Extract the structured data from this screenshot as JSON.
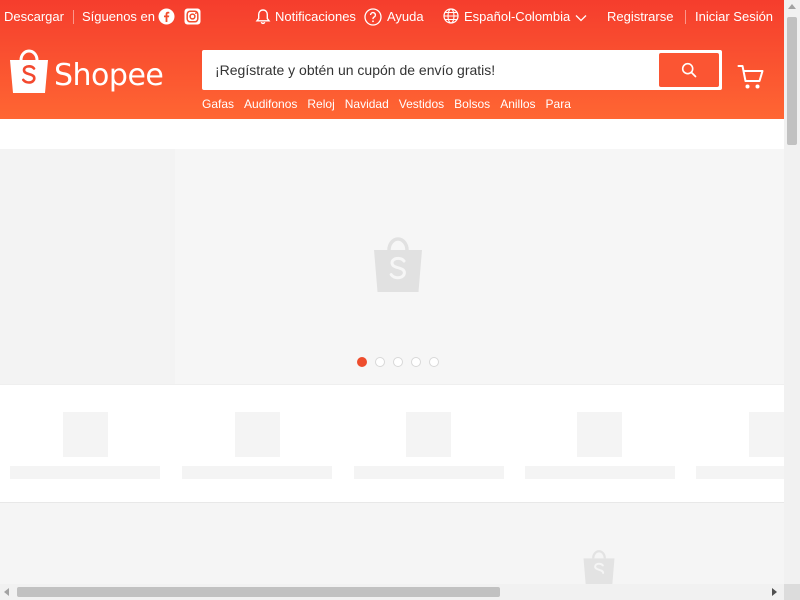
{
  "topbar": {
    "download": "Descargar",
    "follow": "Síguenos en",
    "notifications": "Notificaciones",
    "help": "Ayuda",
    "language": "Español-Colombia",
    "register": "Registrarse",
    "login": "Iniciar Sesión"
  },
  "logo": {
    "text": "Shopee"
  },
  "search": {
    "placeholder": "¡Regístrate y obtén un cupón de envío gratis!"
  },
  "suggestions": [
    "Gafas",
    "Audifonos",
    "Reloj",
    "Navidad",
    "Vestidos",
    "Bolsos",
    "Anillos",
    "Para"
  ],
  "banner": {
    "slides": 5,
    "active_slide": 1
  },
  "colors": {
    "brand": "#ee4d2d",
    "header_top": "#f53d2d",
    "header_bottom": "#ff6633"
  },
  "icons": [
    "facebook-icon",
    "instagram-icon",
    "bell-icon",
    "help-icon",
    "globe-icon",
    "chevron-down-icon",
    "search-icon",
    "cart-icon",
    "shopee-bag-icon"
  ]
}
